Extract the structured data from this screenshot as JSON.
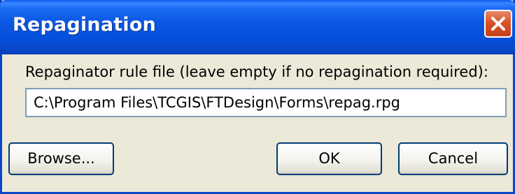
{
  "window": {
    "title": "Repagination",
    "close_icon": "close-icon"
  },
  "form": {
    "prompt_label": "Repaginator rule file (leave empty if no repagination required):",
    "file_path_value": "C:\\Program Files\\TCGIS\\FTDesign\\Forms\\repag.rpg"
  },
  "buttons": {
    "browse_label": "Browse...",
    "ok_label": "OK",
    "cancel_label": "Cancel"
  },
  "colors": {
    "titlebar": "#0b57e5",
    "dialog_background": "#ece9d8",
    "close_button": "#d9522a",
    "input_border": "#7f9db9",
    "button_border": "#003c74"
  }
}
